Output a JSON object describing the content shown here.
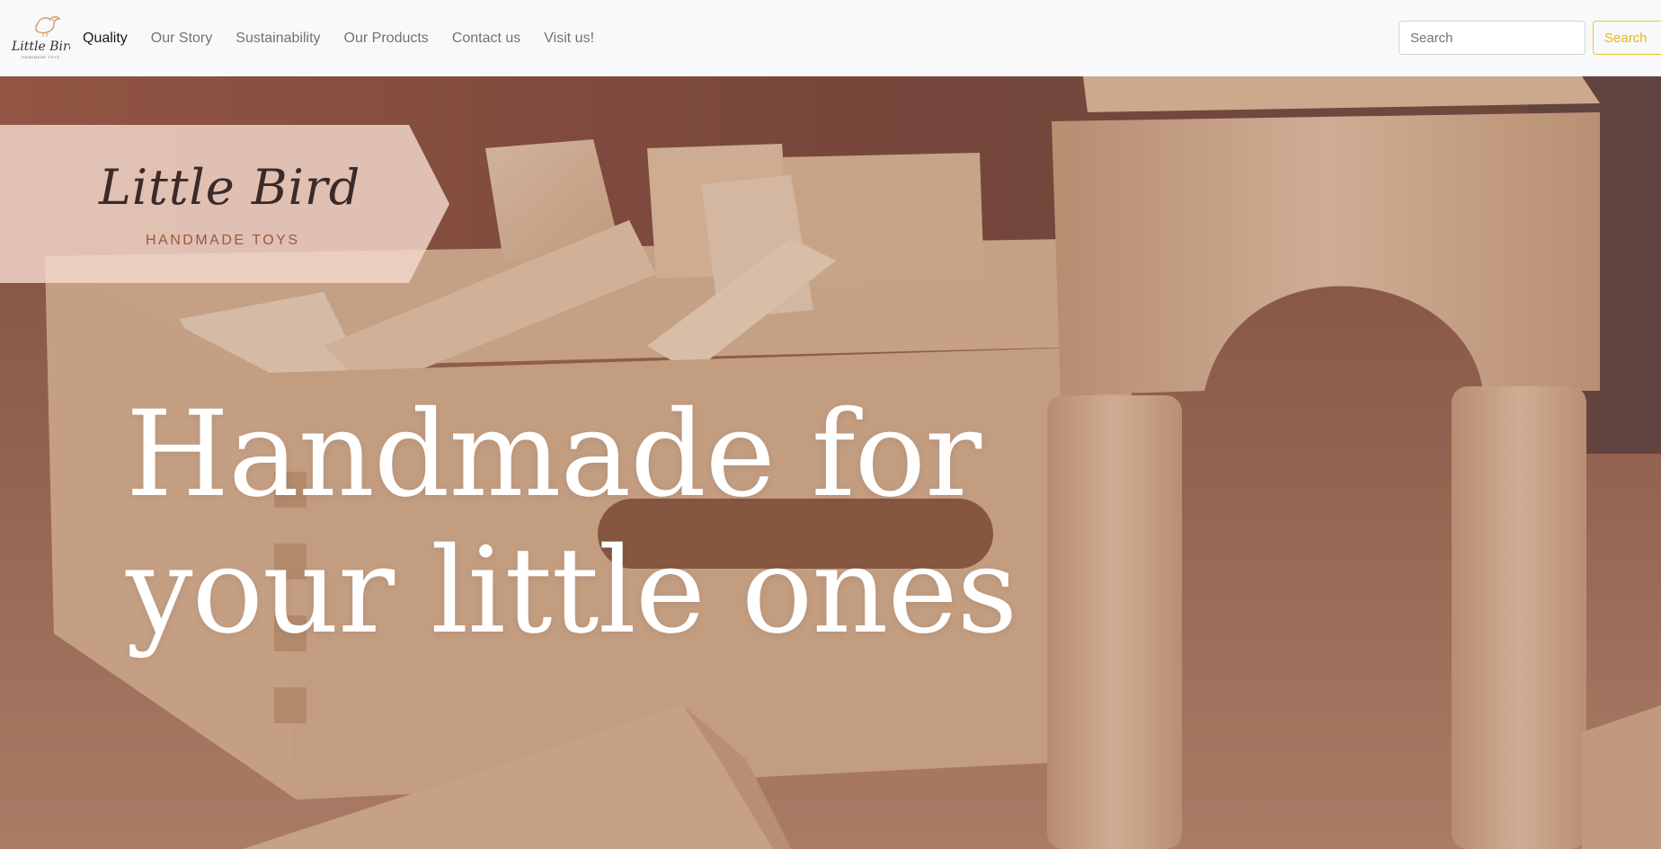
{
  "brand": {
    "name": "Little Bird",
    "tagline": "HANDMADE TOYS",
    "logo_icon": "bird-logo-icon"
  },
  "nav": {
    "items": [
      {
        "label": "Quality",
        "active": true
      },
      {
        "label": "Our Story",
        "active": false
      },
      {
        "label": "Sustainability",
        "active": false
      },
      {
        "label": "Our Products",
        "active": false
      },
      {
        "label": "Contact us",
        "active": false
      },
      {
        "label": "Visit us!",
        "active": false
      }
    ]
  },
  "search": {
    "placeholder": "Search",
    "value": "",
    "button_label": "Search"
  },
  "hero": {
    "banner_title": "Little Bird",
    "banner_subtitle": "HANDMADE TOYS",
    "headline_line1": "Handmade for",
    "headline_line2": "your little ones"
  },
  "colors": {
    "navbar_bg": "#f8f9fa",
    "accent": "#f1c232",
    "banner_fill": "#f3d9cc",
    "headline": "#ffffff"
  }
}
